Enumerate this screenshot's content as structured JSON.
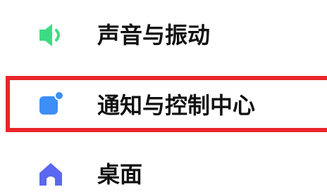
{
  "settings": {
    "items": [
      {
        "label": "声音与振动",
        "icon": "speaker-icon",
        "color": "#3ddc84"
      },
      {
        "label": "通知与控制中心",
        "icon": "notification-icon",
        "color": "#3d8ef7"
      },
      {
        "label": "桌面",
        "icon": "home-icon",
        "color": "#5b67f0"
      }
    ],
    "highlight_color": "#e8262a"
  }
}
